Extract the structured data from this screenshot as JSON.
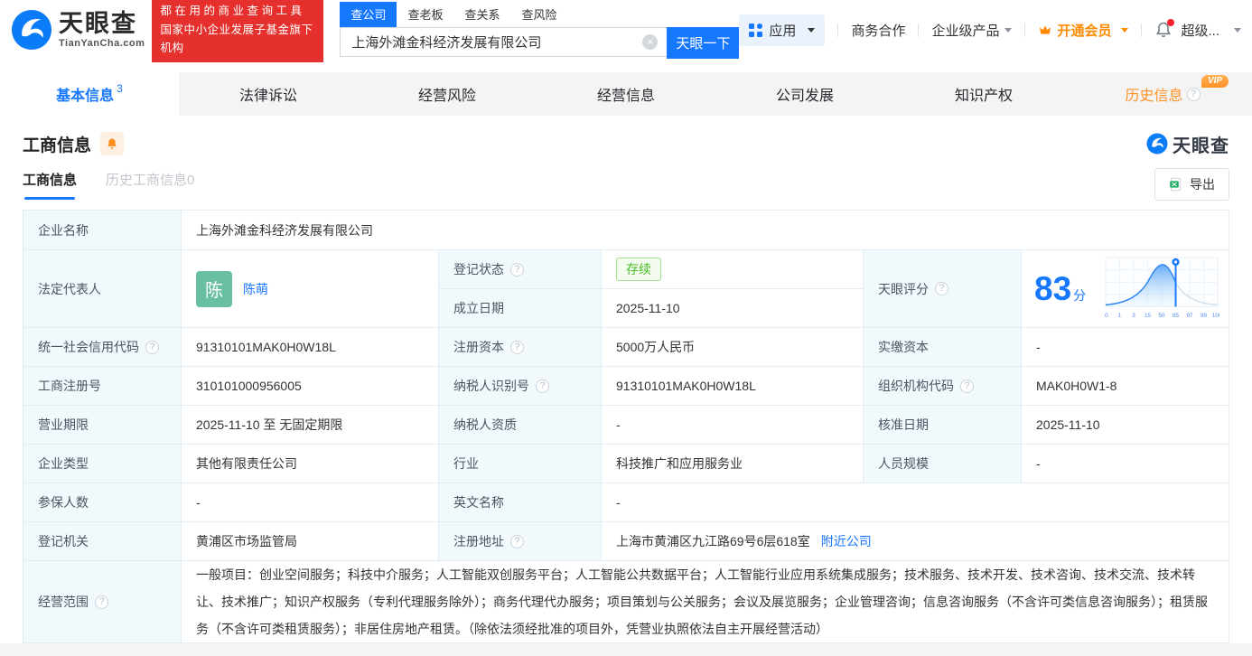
{
  "header": {
    "logo_name": "天眼查",
    "logo_domain": "TianYanCha.com",
    "banner_line1": "都在用的商业查询工具",
    "banner_line2": "国家中小企业发展子基金旗下机构",
    "search_tabs": [
      "查公司",
      "查老板",
      "查关系",
      "查风险"
    ],
    "search_value": "上海外滩金科经济发展有限公司",
    "search_button": "天眼一下",
    "nav": {
      "apps": "应用",
      "cooperation": "商务合作",
      "enterprise": "企业级产品",
      "vip": "开通会员",
      "super_vip": "超级..."
    }
  },
  "page_tabs": [
    {
      "label": "基本信息",
      "badge": "3"
    },
    {
      "label": "法律诉讼"
    },
    {
      "label": "经营风险"
    },
    {
      "label": "经营信息"
    },
    {
      "label": "公司发展"
    },
    {
      "label": "知识产权"
    },
    {
      "label": "历史信息",
      "vip": "VIP"
    }
  ],
  "section": {
    "title": "工商信息",
    "watermark": "天眼查",
    "subtabs": [
      "工商信息",
      "历史工商信息0"
    ],
    "export_label": "导出"
  },
  "info": {
    "company_name_label": "企业名称",
    "company_name": "上海外滩金科经济发展有限公司",
    "legal_rep_label": "法定代表人",
    "legal_rep_avatar": "陈",
    "legal_rep_name": "陈萌",
    "reg_status_label": "登记状态",
    "reg_status": "存续",
    "est_date_label": "成立日期",
    "est_date": "2025-11-10",
    "score_label": "天眼评分",
    "uscc_label": "统一社会信用代码",
    "uscc": "91310101MAK0H0W18L",
    "reg_capital_label": "注册资本",
    "reg_capital": "5000万人民币",
    "paid_capital_label": "实缴资本",
    "paid_capital": "-",
    "reg_no_label": "工商注册号",
    "reg_no": "310101000956005",
    "taxpayer_id_label": "纳税人识别号",
    "taxpayer_id": "91310101MAK0H0W18L",
    "org_code_label": "组织机构代码",
    "org_code": "MAK0H0W1-8",
    "term_label": "营业期限",
    "term": "2025-11-10 至 无固定期限",
    "taxpayer_qual_label": "纳税人资质",
    "taxpayer_qual": "-",
    "approval_date_label": "核准日期",
    "approval_date": "2025-11-10",
    "company_type_label": "企业类型",
    "company_type": "其他有限责任公司",
    "industry_label": "行业",
    "industry": "科技推广和应用服务业",
    "staff_size_label": "人员规模",
    "staff_size": "-",
    "insured_label": "参保人数",
    "insured": "-",
    "en_name_label": "英文名称",
    "en_name": "-",
    "authority_label": "登记机关",
    "authority": "黄浦区市场监管局",
    "address_label": "注册地址",
    "address": "上海市黄浦区九江路69号6层618室",
    "nearby_link": "附近公司",
    "scope_label": "经营范围",
    "scope": "一般项目：创业空间服务；科技中介服务；人工智能双创服务平台；人工智能公共数据平台；人工智能行业应用系统集成服务；技术服务、技术开发、技术咨询、技术交流、技术转让、技术推广；知识产权服务（专利代理服务除外）；商务代理代办服务；项目策划与公关服务；会议及展览服务；企业管理咨询；信息咨询服务（不含许可类信息咨询服务）；租赁服务（不含许可类租赁服务）；非居住房地产租赁。（除依法须经批准的项目外，凭营业执照依法自主开展经营活动）"
  },
  "chart_data": {
    "type": "area",
    "title": "天眼评分",
    "score": "83",
    "score_unit": "分",
    "x_ticks": [
      "0",
      "1",
      "3",
      "15",
      "50",
      "85",
      "97",
      "99",
      "100"
    ],
    "marker_value": 85,
    "note": "bell-curve score distribution, blue fill left of marker at 85",
    "accent_color": "#1677ff"
  },
  "icons": {
    "help": "?",
    "clear": "×"
  }
}
